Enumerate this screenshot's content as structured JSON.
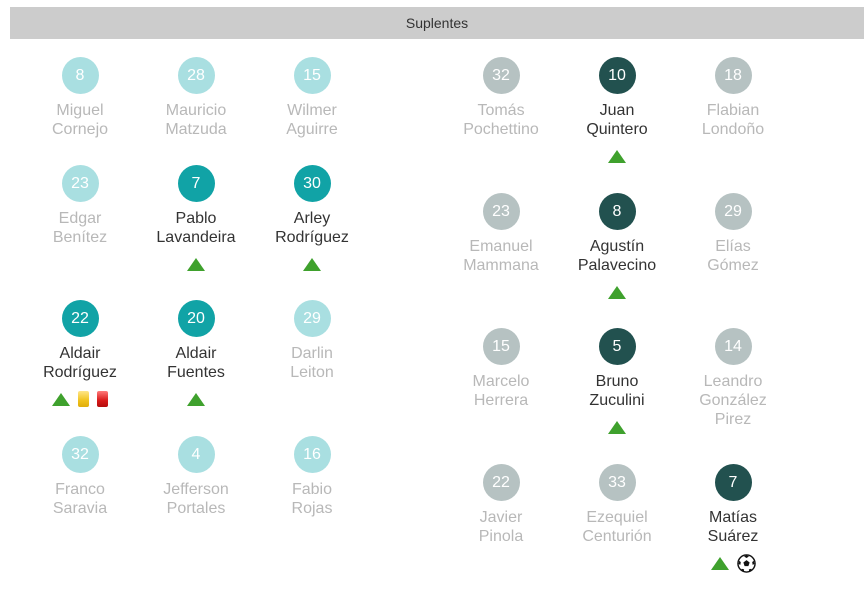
{
  "header": {
    "title": "Suplentes"
  },
  "left_team": [
    {
      "number": "8",
      "name": "Miguel\nCornejo",
      "entered": false
    },
    {
      "number": "28",
      "name": "Mauricio\nMatzuda",
      "entered": false
    },
    {
      "number": "15",
      "name": "Wilmer\nAguirre",
      "entered": false
    },
    {
      "number": "23",
      "name": "Edgar\nBenítez",
      "entered": false
    },
    {
      "number": "7",
      "name": "Pablo\nLavandeira",
      "entered": true,
      "events": [
        "sub-in"
      ]
    },
    {
      "number": "30",
      "name": "Arley\nRodríguez",
      "entered": true,
      "events": [
        "sub-in"
      ]
    },
    {
      "number": "22",
      "name": "Aldair\nRodríguez",
      "entered": true,
      "events": [
        "sub-in",
        "yellow-card",
        "red-card"
      ]
    },
    {
      "number": "20",
      "name": "Aldair\nFuentes",
      "entered": true,
      "events": [
        "sub-in"
      ]
    },
    {
      "number": "29",
      "name": "Darlin\nLeiton",
      "entered": false
    },
    {
      "number": "32",
      "name": "Franco\nSaravia",
      "entered": false
    },
    {
      "number": "4",
      "name": "Jefferson\nPortales",
      "entered": false
    },
    {
      "number": "16",
      "name": "Fabio\nRojas",
      "entered": false
    }
  ],
  "right_team": [
    {
      "number": "32",
      "name": "Tomás\nPochettino",
      "entered": false
    },
    {
      "number": "10",
      "name": "Juan\nQuintero",
      "entered": true,
      "events": [
        "sub-in"
      ]
    },
    {
      "number": "18",
      "name": "Flabian\nLondoño",
      "entered": false
    },
    {
      "number": "23",
      "name": "Emanuel\nMammana",
      "entered": false
    },
    {
      "number": "8",
      "name": "Agustín\nPalavecino",
      "entered": true,
      "events": [
        "sub-in"
      ]
    },
    {
      "number": "29",
      "name": "Elías\nGómez",
      "entered": false
    },
    {
      "number": "15",
      "name": "Marcelo\nHerrera",
      "entered": false
    },
    {
      "number": "5",
      "name": "Bruno\nZuculini",
      "entered": true,
      "events": [
        "sub-in"
      ]
    },
    {
      "number": "14",
      "name": "Leandro\nGonzález\nPirez",
      "entered": false
    },
    {
      "number": "22",
      "name": "Javier\nPinola",
      "entered": false
    },
    {
      "number": "33",
      "name": "Ezequiel\nCenturión",
      "entered": false
    },
    {
      "number": "7",
      "name": "Matías\nSuárez",
      "entered": true,
      "events": [
        "sub-in",
        "goal"
      ]
    }
  ],
  "colors": {
    "left_entered": "#11a3a6",
    "left_unused": "#a9dfe1",
    "right_entered": "#22514f",
    "right_unused": "#b6c2c2",
    "sub_in_arrow": "#3fa12d"
  }
}
